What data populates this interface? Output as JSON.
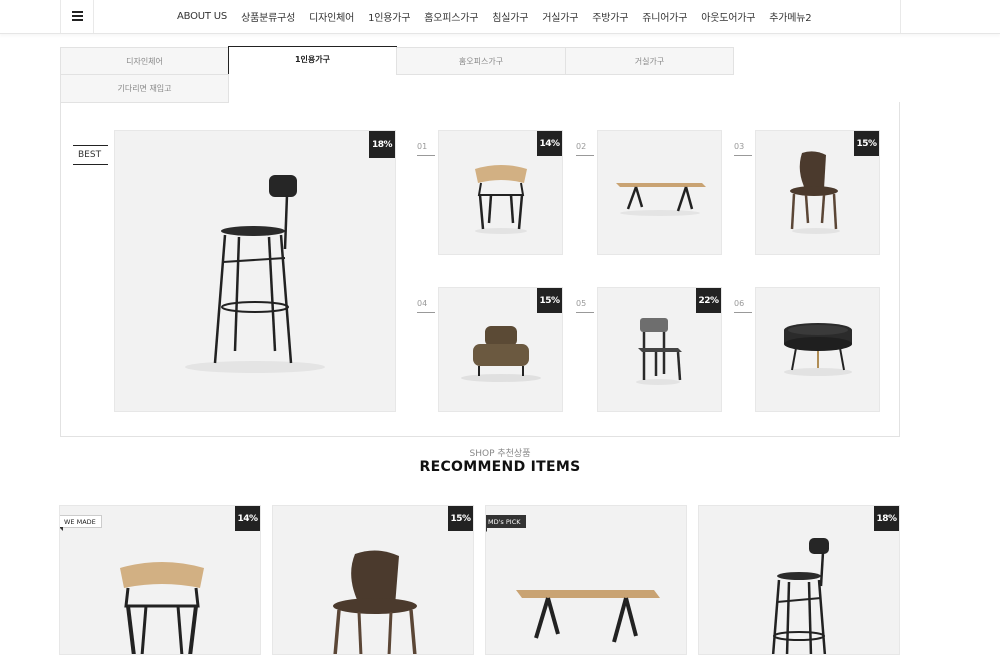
{
  "header": {
    "menu_icon": "hamburger-icon",
    "nav": [
      "ABOUT US",
      "상품분류구성",
      "디자인체어",
      "1인용가구",
      "홈오피스가구",
      "침실가구",
      "거실가구",
      "주방가구",
      "쥬니어가구",
      "아웃도어가구",
      "추가메뉴2"
    ]
  },
  "tabs": [
    {
      "label": "디자인체어",
      "active": false
    },
    {
      "label": "1인용가구",
      "active": true
    },
    {
      "label": "홈오피스가구",
      "active": false
    },
    {
      "label": "거실가구",
      "active": false
    },
    {
      "label": "기다리면 재입고",
      "active": false
    }
  ],
  "best": {
    "label": "BEST",
    "main_discount": "18%",
    "items": [
      {
        "rank": "01",
        "discount": "14%",
        "product": "wood-armchair"
      },
      {
        "rank": "02",
        "discount": "",
        "product": "wood-bench"
      },
      {
        "rank": "03",
        "discount": "15%",
        "product": "wood-chair"
      },
      {
        "rank": "04",
        "discount": "15%",
        "product": "lounge-daybed"
      },
      {
        "rank": "05",
        "discount": "22%",
        "product": "grey-chair"
      },
      {
        "rank": "06",
        "discount": "",
        "product": "tray-table"
      }
    ]
  },
  "recommend": {
    "subtitle": "SHOP 추천상품",
    "title": "RECOMMEND ITEMS",
    "items": [
      {
        "tag": "WE MADE",
        "tag_style": "white",
        "discount": "14%"
      },
      {
        "tag": "",
        "tag_style": "",
        "discount": "15%"
      },
      {
        "tag": "MD's PICK",
        "tag_style": "dark",
        "discount": ""
      },
      {
        "tag": "",
        "tag_style": "",
        "discount": "18%"
      }
    ]
  }
}
